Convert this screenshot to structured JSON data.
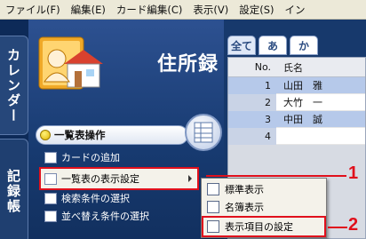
{
  "menubar": {
    "items": [
      "ファイル(F)",
      "編集(E)",
      "カード編集(C)",
      "表示(V)",
      "設定(S)",
      "イン"
    ]
  },
  "sidetabs": {
    "calendar": "カレンダー",
    "record": "記録帳"
  },
  "app": {
    "title": "住所録"
  },
  "section": {
    "label": "一覧表操作"
  },
  "menu": {
    "items": [
      "カードの追加",
      "一覧表の表示設定",
      "検索条件の選択",
      "並べ替え条件の選択"
    ]
  },
  "tabs": [
    "全て",
    "あ",
    "か"
  ],
  "list": {
    "headers": {
      "no": "No.",
      "name": "氏名"
    },
    "rows": [
      {
        "no": "1",
        "name": "山田　雅",
        "highlight": true
      },
      {
        "no": "2",
        "name": "大竹　一",
        "highlight": false
      },
      {
        "no": "3",
        "name": "中田　誠",
        "highlight": true
      },
      {
        "no": "4",
        "name": "",
        "highlight": false
      }
    ]
  },
  "submenu": {
    "items": [
      "標準表示",
      "名簿表示",
      "表示項目の設定"
    ]
  },
  "callouts": {
    "one": "1",
    "two": "2"
  },
  "colors": {
    "accent_red": "#e0101c",
    "panel_navy": "#0d2a58"
  }
}
